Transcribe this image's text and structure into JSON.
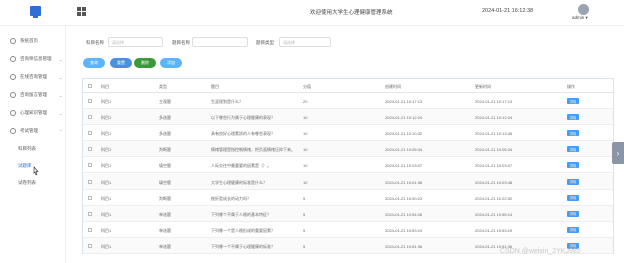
{
  "header": {
    "system_title": "欢迎使用大学生心理健康管理系统",
    "datetime": "2024-01-21 16:12:38",
    "user_name": "admin"
  },
  "sidebar": {
    "items": [
      {
        "label": "系统首页"
      },
      {
        "label": "咨询师信息管理"
      },
      {
        "label": "在线咨询管理"
      },
      {
        "label": "咨询留言管理"
      },
      {
        "label": "心理知识管理"
      },
      {
        "label": "考试管理"
      }
    ],
    "subitems": [
      {
        "label": "科目列表"
      },
      {
        "label": "试题库"
      },
      {
        "label": "试卷列表"
      }
    ]
  },
  "filters": {
    "subject_label": "科目名称",
    "subject_placeholder": "请选择",
    "question_label": "题目名称",
    "question_placeholder": "",
    "type_label": "题目类型",
    "type_placeholder": "请选择"
  },
  "buttons": {
    "search": "查询",
    "reset": "重置",
    "delete": "删除",
    "add": "添加"
  },
  "table": {
    "headers": [
      "科目",
      "类型",
      "题目",
      "分值",
      "创建时间",
      "更新时间",
      "操作"
    ],
    "rows": [
      [
        "科目1",
        "主观题",
        "生涯规划是什么？",
        "20",
        "2024-01-21 10:17:13",
        "2024-01-21 10:17:13",
        "详情"
      ],
      [
        "科目1",
        "多选题",
        "以下哪些行为属于心理健康的表现？",
        "10",
        "2024-01-21 10:12:24",
        "2024-01-21 10:12:24",
        "详情"
      ],
      [
        "科目1",
        "多选题",
        "具有良好心理素质的人有哪些表现？",
        "10",
        "2024-01-21 10:10:32",
        "2024-01-21 10:13:45",
        "详情"
      ],
      [
        "科目1",
        "判断题",
        "情绪管理是指控制情绪，把负面情绪压抑下来。",
        "10",
        "2024-01-21 10:05:34",
        "2024-01-21 10:05:34",
        "详情"
      ],
      [
        "科目1",
        "填空题",
        "人际交往中最重要的因素是（）。",
        "10",
        "2024-01-21 10:03:07",
        "2024-01-21 10:03:07",
        "详情"
      ],
      [
        "科目1",
        "填空题",
        "大学生心理健康的标准是什么？",
        "10",
        "2024-01-21 10:01:38",
        "2024-01-21 10:03:48",
        "详情"
      ],
      [
        "科目1",
        "判断题",
        "挫折是成长的动力吗？",
        "5",
        "2024-01-21 10:00:23",
        "2024-01-21 10:22:02",
        "详情"
      ],
      [
        "科目1",
        "单选题",
        "下列哪个不属于人格的基本特征？",
        "5",
        "2024-01-21 10:54:26",
        "2024-01-21 10:55:14",
        "详情"
      ],
      [
        "科目1",
        "单选题",
        "下列哪一个是人格形成的重要因素？",
        "5",
        "2024-01-21 10:53:19",
        "2024-01-21 10:53:19",
        "详情"
      ],
      [
        "科目1",
        "单选题",
        "下列哪一个不属于心理健康的标准？",
        "5",
        "2024-01-21 10:51:36",
        "2024-01-21 10:51:36",
        "详情"
      ]
    ]
  },
  "watermark": "CSDN @weixin_2YKJ985",
  "colors": {
    "accent": "#409eff",
    "search_button": "#5cb4ff",
    "reset_button": "#4a90e2",
    "delete_button": "#3a9a3a",
    "add_button": "#5cb4ff"
  }
}
